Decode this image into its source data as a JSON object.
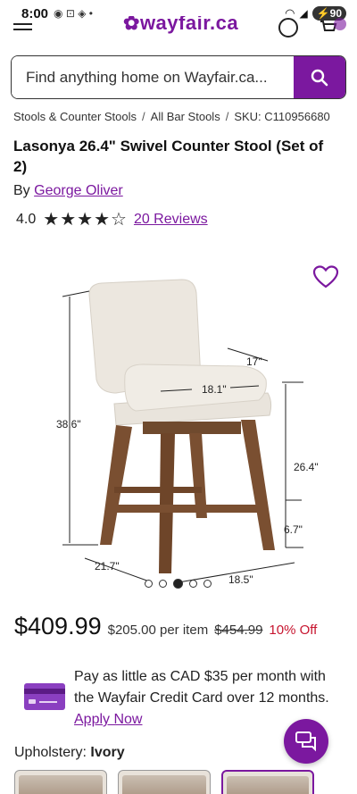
{
  "status_bar": {
    "time": "8:00",
    "battery": "90"
  },
  "header": {
    "logo": "wayfair.ca"
  },
  "search": {
    "placeholder": "Find anything home on Wayfair.ca..."
  },
  "breadcrumb": {
    "items": [
      "Stools & Counter Stools",
      "All Bar Stools"
    ],
    "sku": "SKU: C110956680"
  },
  "product": {
    "title": "Lasonya 26.4\" Swivel Counter Stool (Set of 2)",
    "by_prefix": "By",
    "brand": "George Oliver",
    "rating": "4.0",
    "rating_value": 4,
    "rating_max": 5,
    "reviews": "20 Reviews"
  },
  "gallery": {
    "dimensions": [
      "38.6\"",
      "17\"",
      "18.1\"",
      "26.4\"",
      "6.7\"",
      "21.7\"",
      "18.5\""
    ],
    "total_images": 5,
    "active_index": 2
  },
  "pricing": {
    "price": "$409.99",
    "per_item": "$205.00 per item",
    "old_price": "$454.99",
    "discount": "10% Off"
  },
  "credit_promo": {
    "text": "Pay as little as CAD $35 per month with the Wayfair Credit Card over 12 months.",
    "apply_label": "Apply Now"
  },
  "options": {
    "upholstery_label": "Upholstery:",
    "upholstery_value": "Ivory"
  },
  "colors": {
    "brand": "#7b189f",
    "discount": "#c7152f"
  }
}
